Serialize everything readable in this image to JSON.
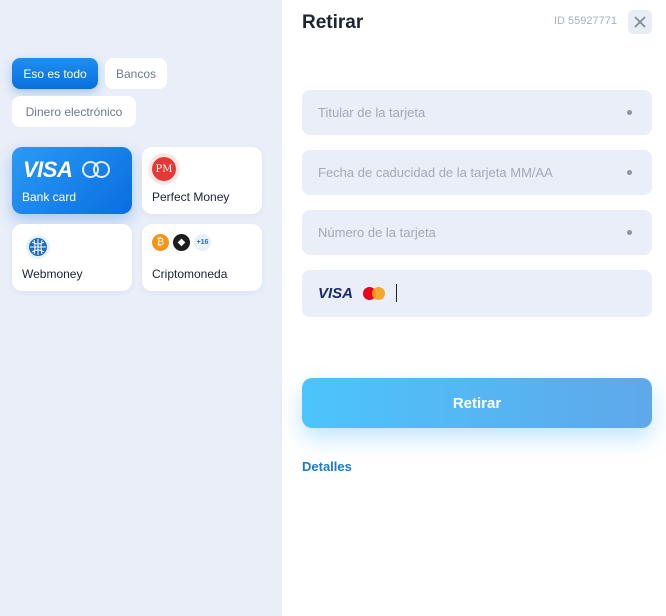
{
  "filters": {
    "all_label": "Eso es todo",
    "banks_label": "Bancos",
    "ewallet_label": "Dinero electrónico"
  },
  "methods": [
    {
      "label": "Bank card",
      "icon": "visa-mastercard-icon",
      "logo_text": "VISA"
    },
    {
      "label": "Perfect Money",
      "icon": "perfect-money-icon",
      "logo_text": "PM"
    },
    {
      "label": "Webmoney",
      "icon": "webmoney-icon"
    },
    {
      "label": "Criptomoneda",
      "icon": "crypto-icons",
      "more_badge": "+16"
    }
  ],
  "withdraw": {
    "title": "Retirar",
    "user_id": "ID 55927771",
    "fields": {
      "card_holder_placeholder": "Titular de la tarjeta",
      "expiry_placeholder": "Fecha de caducidad de la tarjeta MM/AA",
      "card_number_placeholder": "Número de la tarjeta"
    },
    "card_logo_text": "VISA",
    "submit_label": "Retirar",
    "details_link": "Detalles"
  },
  "colors": {
    "accent": "#0a6fdc",
    "button_gradient_start": "#4cc4fc",
    "button_gradient_end": "#5fa8ea",
    "link": "#1a7ad4",
    "panel_bg": "#e9eef8"
  }
}
